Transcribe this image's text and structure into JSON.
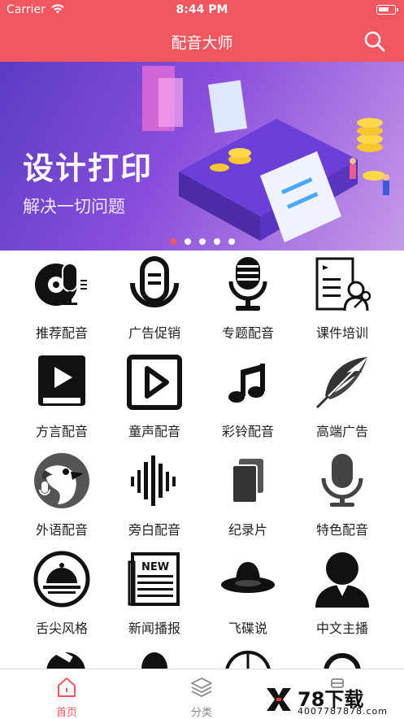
{
  "status": {
    "carrier": "Carrier",
    "time": "8:44 PM"
  },
  "nav": {
    "title": "配音大师"
  },
  "banner": {
    "headline": "设计打印",
    "subtitle": "解决一切问题",
    "page_count": 5,
    "active_index": 0
  },
  "categories": [
    {
      "label": "推荐配音",
      "icon": "vinyl-mic-icon"
    },
    {
      "label": "广告促销",
      "icon": "microphone-ring-icon"
    },
    {
      "label": "专题配音",
      "icon": "studio-microphone-icon"
    },
    {
      "label": "课件培训",
      "icon": "presentation-teacher-icon"
    },
    {
      "label": "方言配音",
      "icon": "video-book-icon"
    },
    {
      "label": "童声配音",
      "icon": "play-square-icon"
    },
    {
      "label": "彩铃配音",
      "icon": "music-note-icon"
    },
    {
      "label": "高端广告",
      "icon": "feather-icon"
    },
    {
      "label": "外语配音",
      "icon": "parrot-icon"
    },
    {
      "label": "旁白配音",
      "icon": "sound-wave-icon"
    },
    {
      "label": "纪录片",
      "icon": "copy-cards-icon"
    },
    {
      "label": "特色配音",
      "icon": "desk-microphone-icon"
    },
    {
      "label": "舌尖风格",
      "icon": "food-cloche-icon"
    },
    {
      "label": "新闻播报",
      "icon": "newspaper-icon"
    },
    {
      "label": "飞碟说",
      "icon": "ufo-hat-icon"
    },
    {
      "label": "中文主播",
      "icon": "anchor-person-icon"
    }
  ],
  "tabs": [
    {
      "label": "首页",
      "icon": "home-icon",
      "active": true
    },
    {
      "label": "分类",
      "icon": "layers-icon",
      "active": false
    }
  ],
  "watermark": {
    "text": "78下载",
    "sub": "4007787878.com"
  }
}
